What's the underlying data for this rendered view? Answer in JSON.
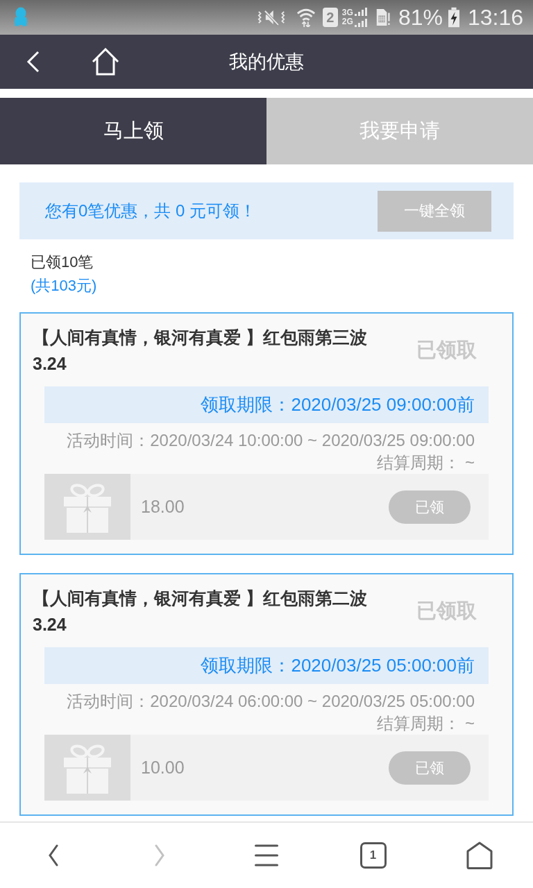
{
  "status_bar": {
    "sim_slot": "2",
    "network_upper": "3G",
    "network_lower": "2G",
    "battery": "81%",
    "time": "13:16"
  },
  "header": {
    "title": "我的优惠"
  },
  "tabs": [
    {
      "label": "马上领",
      "selected": true
    },
    {
      "label": "我要申请",
      "selected": false
    }
  ],
  "summary": {
    "text": "您有0笔优惠，共 0 元可领！",
    "button": {
      "label": "一键全领",
      "disabled": true
    }
  },
  "claimed": {
    "count": "已领10笔",
    "total": "(共103元)"
  },
  "offers": [
    {
      "title": "【人间有真情，银河有真爱 】红包雨第三波 3.24",
      "status": "已领取",
      "deadline": "领取期限：2020/03/25 09:00:00前",
      "activity_time": "活动时间：2020/03/24 10:00:00 ~ 2020/03/25 09:00:00",
      "settlement": "结算周期： ~",
      "amount": "18.00",
      "button": {
        "label": "已领",
        "disabled": true
      }
    },
    {
      "title": "【人间有真情，银河有真爱 】红包雨第二波 3.24",
      "status": "已领取",
      "deadline": "领取期限：2020/03/25 05:00:00前",
      "activity_time": "活动时间：2020/03/24 06:00:00 ~ 2020/03/25 05:00:00",
      "settlement": "结算周期： ~",
      "amount": "10.00",
      "button": {
        "label": "已领",
        "disabled": true
      }
    }
  ],
  "bottom_nav": [
    {
      "kind": "back",
      "disabled": false
    },
    {
      "kind": "forward",
      "disabled": true
    },
    {
      "kind": "menu",
      "disabled": false
    },
    {
      "kind": "tabs",
      "label": "1",
      "disabled": false
    },
    {
      "kind": "home",
      "disabled": false
    }
  ]
}
